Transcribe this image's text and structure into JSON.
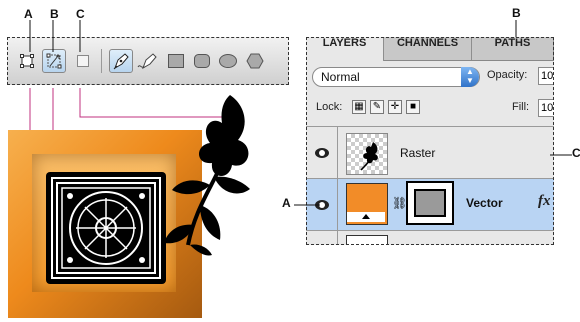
{
  "callouts": {
    "toolbar_a": "A",
    "toolbar_b": "B",
    "toolbar_c": "C",
    "panel_b": "B",
    "panel_a": "A",
    "panel_c": "C"
  },
  "toolbar": {
    "icons": [
      "shape-layers-icon",
      "paths-icon",
      "fill-pixels-icon",
      "pen-icon",
      "freeform-pen-icon",
      "rectangle-icon",
      "rounded-rectangle-icon",
      "ellipse-icon",
      "polygon-icon"
    ],
    "active": "paths-icon"
  },
  "layers_panel": {
    "tabs": [
      "LAYERS",
      "CHANNELS",
      "PATHS"
    ],
    "active_tab": "LAYERS",
    "blend_mode": "Normal",
    "opacity_label": "Opacity:",
    "opacity_value": "10",
    "lock_label": "Lock:",
    "fill_label": "Fill:",
    "fill_value": "10",
    "layers": [
      {
        "name": "Raster",
        "selected": false,
        "visible": true
      },
      {
        "name": "Vector",
        "selected": true,
        "visible": true,
        "fx": "fx"
      }
    ]
  },
  "colors": {
    "orange": "#f28c28",
    "selection": "#b9d4f3",
    "callout_line": "#c0307f"
  }
}
